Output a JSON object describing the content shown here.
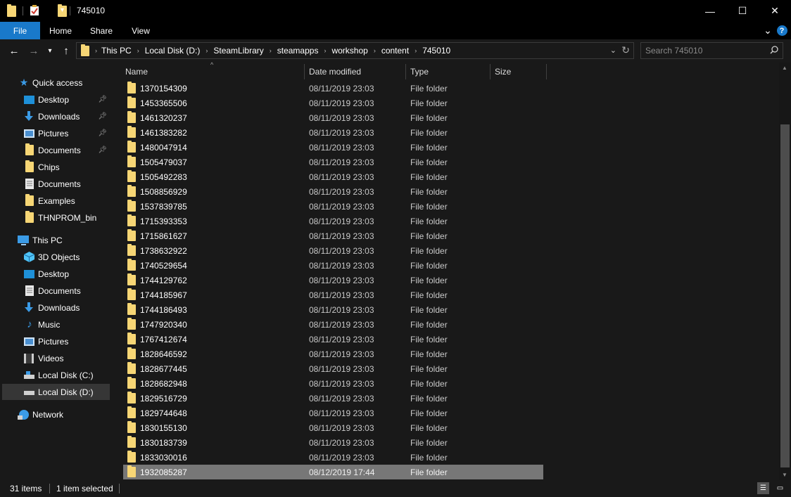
{
  "window": {
    "title": "745010",
    "minimize": "—",
    "maximize": "☐",
    "close": "✕"
  },
  "ribbon": {
    "tabs": [
      "File",
      "Home",
      "Share",
      "View"
    ],
    "expand": "⌄",
    "help": "?"
  },
  "address": {
    "crumbs": [
      "This PC",
      "Local Disk (D:)",
      "SteamLibrary",
      "steamapps",
      "workshop",
      "content",
      "745010"
    ],
    "separator": "›"
  },
  "search": {
    "placeholder": "Search 745010"
  },
  "nav": {
    "quick_access": "Quick access",
    "qa_items": [
      "Desktop",
      "Downloads",
      "Pictures",
      "Documents",
      "Chips",
      "Documents",
      "Examples",
      "THNPROM_bin"
    ],
    "this_pc": "This PC",
    "pc_items": [
      "3D Objects",
      "Desktop",
      "Documents",
      "Downloads",
      "Music",
      "Pictures",
      "Videos",
      "Local Disk (C:)",
      "Local Disk (D:)"
    ],
    "network": "Network"
  },
  "columns": {
    "name": "Name",
    "date": "Date modified",
    "type": "Type",
    "size": "Size"
  },
  "files": [
    {
      "name": "1370154309",
      "date": "08/11/2019 23:03",
      "type": "File folder"
    },
    {
      "name": "1453365506",
      "date": "08/11/2019 23:03",
      "type": "File folder"
    },
    {
      "name": "1461320237",
      "date": "08/11/2019 23:03",
      "type": "File folder"
    },
    {
      "name": "1461383282",
      "date": "08/11/2019 23:03",
      "type": "File folder"
    },
    {
      "name": "1480047914",
      "date": "08/11/2019 23:03",
      "type": "File folder"
    },
    {
      "name": "1505479037",
      "date": "08/11/2019 23:03",
      "type": "File folder"
    },
    {
      "name": "1505492283",
      "date": "08/11/2019 23:03",
      "type": "File folder"
    },
    {
      "name": "1508856929",
      "date": "08/11/2019 23:03",
      "type": "File folder"
    },
    {
      "name": "1537839785",
      "date": "08/11/2019 23:03",
      "type": "File folder"
    },
    {
      "name": "1715393353",
      "date": "08/11/2019 23:03",
      "type": "File folder"
    },
    {
      "name": "1715861627",
      "date": "08/11/2019 23:03",
      "type": "File folder"
    },
    {
      "name": "1738632922",
      "date": "08/11/2019 23:03",
      "type": "File folder"
    },
    {
      "name": "1740529654",
      "date": "08/11/2019 23:03",
      "type": "File folder"
    },
    {
      "name": "1744129762",
      "date": "08/11/2019 23:03",
      "type": "File folder"
    },
    {
      "name": "1744185967",
      "date": "08/11/2019 23:03",
      "type": "File folder"
    },
    {
      "name": "1744186493",
      "date": "08/11/2019 23:03",
      "type": "File folder"
    },
    {
      "name": "1747920340",
      "date": "08/11/2019 23:03",
      "type": "File folder"
    },
    {
      "name": "1767412674",
      "date": "08/11/2019 23:03",
      "type": "File folder"
    },
    {
      "name": "1828646592",
      "date": "08/11/2019 23:03",
      "type": "File folder"
    },
    {
      "name": "1828677445",
      "date": "08/11/2019 23:03",
      "type": "File folder"
    },
    {
      "name": "1828682948",
      "date": "08/11/2019 23:03",
      "type": "File folder"
    },
    {
      "name": "1829516729",
      "date": "08/11/2019 23:03",
      "type": "File folder"
    },
    {
      "name": "1829744648",
      "date": "08/11/2019 23:03",
      "type": "File folder"
    },
    {
      "name": "1830155130",
      "date": "08/11/2019 23:03",
      "type": "File folder"
    },
    {
      "name": "1830183739",
      "date": "08/11/2019 23:03",
      "type": "File folder"
    },
    {
      "name": "1833030016",
      "date": "08/11/2019 23:03",
      "type": "File folder"
    },
    {
      "name": "1932085287",
      "date": "08/12/2019 17:44",
      "type": "File folder",
      "selected": true
    }
  ],
  "status": {
    "items": "31 items",
    "selected": "1 item selected"
  },
  "colors": {
    "accent": "#1979ca",
    "folder": "#f7d675",
    "background": "#191919",
    "selection": "#777777"
  }
}
